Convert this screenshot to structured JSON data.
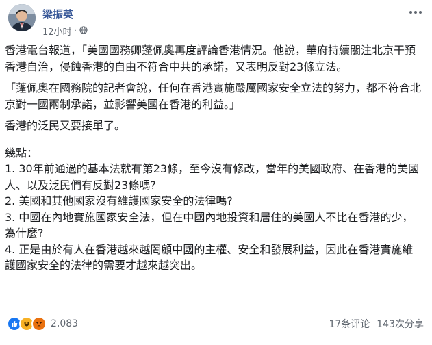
{
  "post": {
    "author": "梁振英",
    "time": "12小时",
    "privacy_icon": "globe-icon",
    "paragraphs": [
      "香港電台報道，「美國國務卿蓬佩奧再度評論香港情況。他說，華府持續關注北京干預香港自治，侵蝕香港的自由不符合中共的承諾，又表明反對23條立法。",
      "「蓬佩奧在國務院的記者會說，任何在香港實施嚴厲國家安全立法的努力，都不符合北京對一國兩制承諾，並影響美國在香港的利益。」",
      "香港的泛民又要接單了。"
    ],
    "points_title": "幾點：",
    "points": [
      "1. 30年前通過的基本法就有第23條，至今沒有修改，當年的美國政府、在香港的美國人、以及泛民們有反對23條嗎?",
      "2. 美國和其他國家沒有維護國家安全的法律嗎?",
      "3. 中國在內地實施國家安全法，但在中國內地投資和居住的美國人不比在香港的少，為什麼?",
      "4. 正是由於有人在香港越來越罔顧中國的主權、安全和發展利益，因此在香港實施維護國家安全的法律的需要才越來越突出。"
    ]
  },
  "footer": {
    "reaction_icons": [
      "like-icon",
      "haha-icon",
      "angry-icon"
    ],
    "reaction_count": "2,083",
    "comments": "17条评论",
    "shares": "143次分享"
  }
}
